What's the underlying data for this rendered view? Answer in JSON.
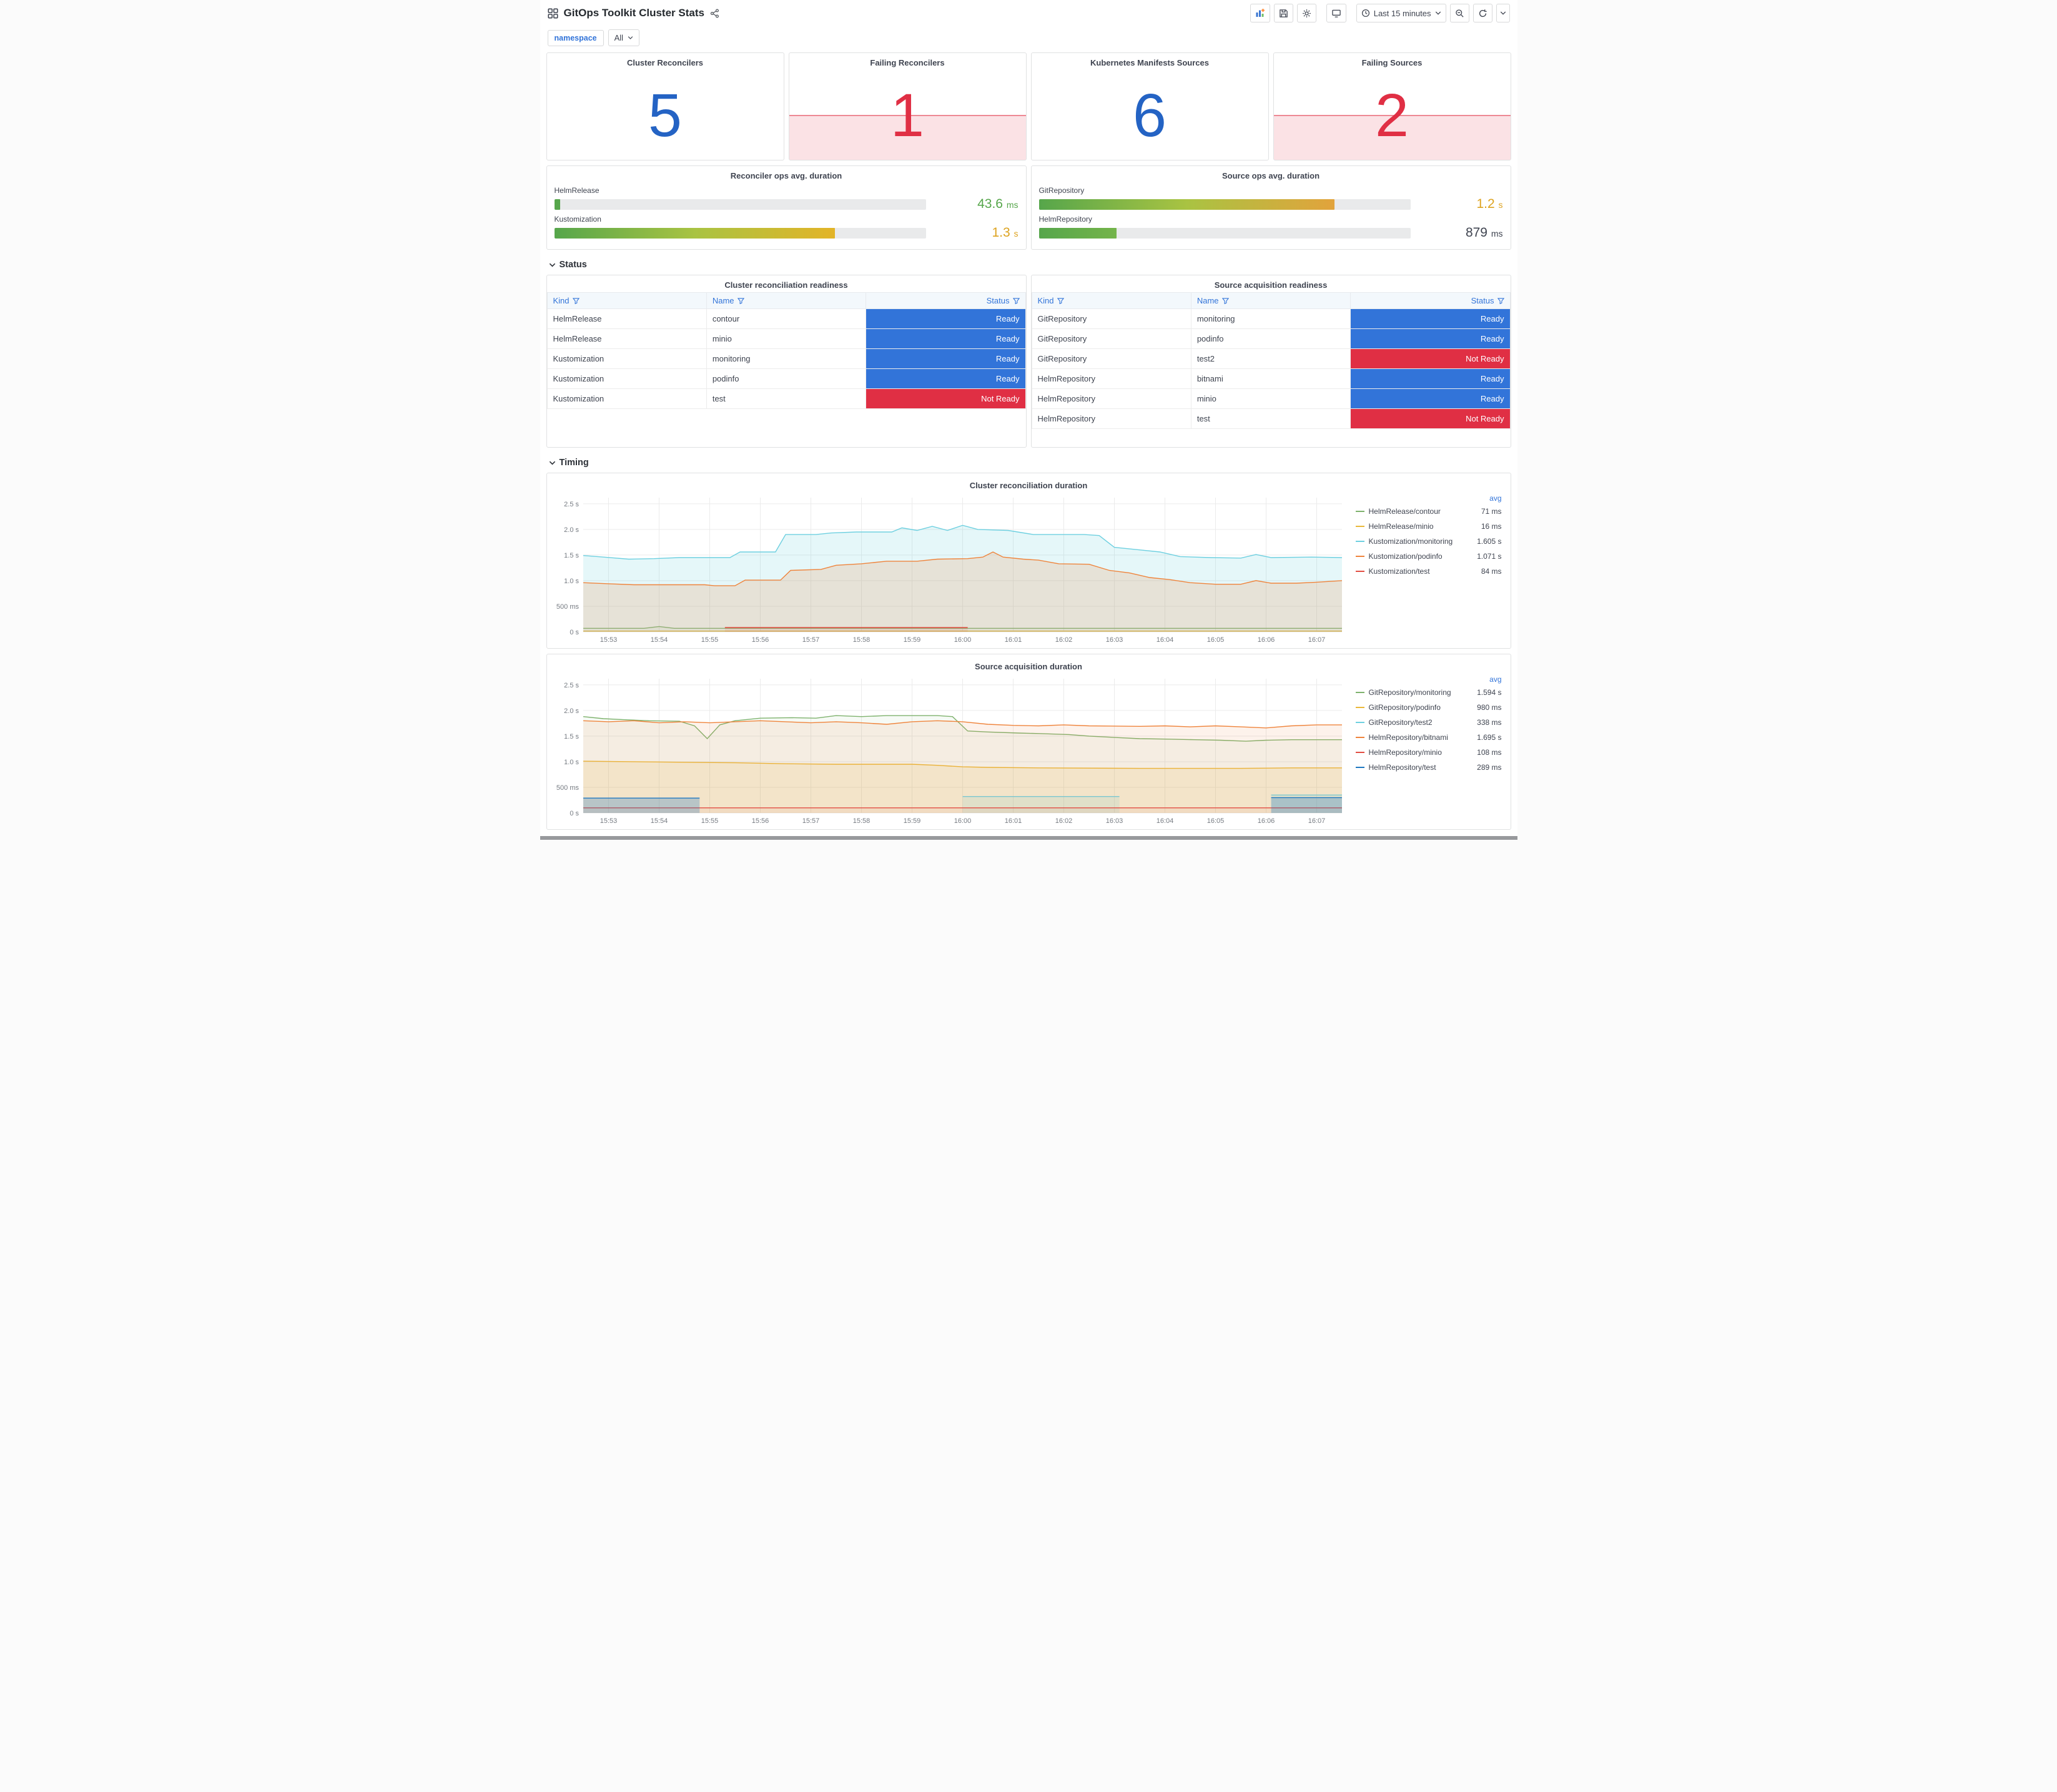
{
  "header": {
    "title": "GitOps Toolkit Cluster Stats"
  },
  "toolbar": {
    "time_range": "Last 15 minutes",
    "icons": [
      "add-panel",
      "save",
      "settings",
      "tv-mode",
      "clock",
      "zoom-out",
      "refresh",
      "caret-down"
    ]
  },
  "variables": {
    "label": "namespace",
    "value": "All"
  },
  "sections": {
    "status": "Status",
    "timing": "Timing"
  },
  "theme": {
    "accent_blue": "#3274d9",
    "stat_blue": "#2463c4",
    "stat_red": "#e02f44",
    "ready_blue": "#3274d9",
    "not_ready_red": "#e02f44",
    "gauge_green": "#56a64b",
    "gauge_yellow": "#e3b427",
    "text_dark": "#3f4450"
  },
  "stats": [
    {
      "title": "Cluster Reconcilers",
      "value": "5",
      "color": "#2463c4",
      "alert": false
    },
    {
      "title": "Failing Reconcilers",
      "value": "1",
      "color": "#e02f44",
      "alert": true
    },
    {
      "title": "Kubernetes Manifests Sources",
      "value": "6",
      "color": "#2463c4",
      "alert": false
    },
    {
      "title": "Failing Sources",
      "value": "2",
      "color": "#e02f44",
      "alert": true
    }
  ],
  "gauges": [
    {
      "title": "Reconciler ops avg. duration",
      "bars": [
        {
          "label": "HelmRelease",
          "value": "43.6",
          "unit": "ms",
          "pct": 1.6,
          "colors": [
            "#56a64b"
          ],
          "value_color": "#56a64b"
        },
        {
          "label": "Kustomization",
          "value": "1.3",
          "unit": "s",
          "pct": 75.5,
          "colors": [
            "#56a64b",
            "#a9c342",
            "#e3b427"
          ],
          "value_color": "#dda320"
        }
      ]
    },
    {
      "title": "Source ops avg. duration",
      "bars": [
        {
          "label": "GitRepository",
          "value": "1.2",
          "unit": "s",
          "pct": 79.5,
          "colors": [
            "#56a64b",
            "#a9c342",
            "#e2a33c"
          ],
          "value_color": "#dda320"
        },
        {
          "label": "HelmRepository",
          "value": "879",
          "unit": "ms",
          "pct": 21,
          "colors": [
            "#56a64b",
            "#74b44a"
          ],
          "value_color": "#3f4450"
        }
      ]
    }
  ],
  "tables": [
    {
      "title": "Cluster reconciliation readiness",
      "columns": [
        "Kind",
        "Name",
        "Status"
      ],
      "rows": [
        {
          "kind": "HelmRelease",
          "name": "contour",
          "status": "Ready",
          "ok": true
        },
        {
          "kind": "HelmRelease",
          "name": "minio",
          "status": "Ready",
          "ok": true
        },
        {
          "kind": "Kustomization",
          "name": "monitoring",
          "status": "Ready",
          "ok": true
        },
        {
          "kind": "Kustomization",
          "name": "podinfo",
          "status": "Ready",
          "ok": true
        },
        {
          "kind": "Kustomization",
          "name": "test",
          "status": "Not Ready",
          "ok": false
        }
      ]
    },
    {
      "title": "Source acquisition readiness",
      "columns": [
        "Kind",
        "Name",
        "Status"
      ],
      "rows": [
        {
          "kind": "GitRepository",
          "name": "monitoring",
          "status": "Ready",
          "ok": true
        },
        {
          "kind": "GitRepository",
          "name": "podinfo",
          "status": "Ready",
          "ok": true
        },
        {
          "kind": "GitRepository",
          "name": "test2",
          "status": "Not Ready",
          "ok": false
        },
        {
          "kind": "HelmRepository",
          "name": "bitnami",
          "status": "Ready",
          "ok": true
        },
        {
          "kind": "HelmRepository",
          "name": "minio",
          "status": "Ready",
          "ok": true
        },
        {
          "kind": "HelmRepository",
          "name": "test",
          "status": "Not Ready",
          "ok": false
        }
      ]
    }
  ],
  "chart_data": [
    {
      "type": "line",
      "title": "Cluster reconciliation duration",
      "legend_header": "avg",
      "xmin": 0,
      "xmax": 15,
      "ymin": 0,
      "ymax": 2.62,
      "grid": true,
      "legend_position": "right",
      "xticks": [
        "15:53",
        "15:54",
        "15:55",
        "15:56",
        "15:57",
        "15:58",
        "15:59",
        "16:00",
        "16:01",
        "16:02",
        "16:03",
        "16:04",
        "16:05",
        "16:06",
        "16:07"
      ],
      "yticks": [
        {
          "v": 0,
          "label": "0 s"
        },
        {
          "v": 0.5,
          "label": "500 ms"
        },
        {
          "v": 1,
          "label": "1.0 s"
        },
        {
          "v": 1.5,
          "label": "1.5 s"
        },
        {
          "v": 2,
          "label": "2.0 s"
        },
        {
          "v": 2.5,
          "label": "2.5 s"
        }
      ],
      "series": [
        {
          "name": "HelmRelease/contour",
          "avg": "71 ms",
          "color": "#7eb26d",
          "fill_opacity": 0.08,
          "points": [
            [
              0,
              0.07
            ],
            [
              1.2,
              0.07
            ],
            [
              1.5,
              0.105
            ],
            [
              1.8,
              0.07
            ],
            [
              15,
              0.07
            ]
          ]
        },
        {
          "name": "HelmRelease/minio",
          "avg": "16 ms",
          "color": "#eab839",
          "fill_opacity": 0.06,
          "points": [
            [
              0,
              0.016
            ],
            [
              15,
              0.016
            ]
          ]
        },
        {
          "name": "Kustomization/monitoring",
          "avg": "1.605 s",
          "color": "#6ed0e0",
          "fill_opacity": 0.18,
          "points": [
            [
              0,
              1.49
            ],
            [
              0.4,
              1.46
            ],
            [
              0.9,
              1.42
            ],
            [
              1.4,
              1.43
            ],
            [
              1.9,
              1.45
            ],
            [
              2.9,
              1.45
            ],
            [
              3.1,
              1.56
            ],
            [
              3.8,
              1.56
            ],
            [
              4,
              1.9
            ],
            [
              4.6,
              1.9
            ],
            [
              4.9,
              1.93
            ],
            [
              5.4,
              1.95
            ],
            [
              6.1,
              1.95
            ],
            [
              6.3,
              2.03
            ],
            [
              6.6,
              1.98
            ],
            [
              6.9,
              2.06
            ],
            [
              7.2,
              1.98
            ],
            [
              7.5,
              2.08
            ],
            [
              7.8,
              2.0
            ],
            [
              8.4,
              1.98
            ],
            [
              8.9,
              1.9
            ],
            [
              9.9,
              1.9
            ],
            [
              10.2,
              1.88
            ],
            [
              10.5,
              1.65
            ],
            [
              11,
              1.6
            ],
            [
              11.4,
              1.56
            ],
            [
              11.8,
              1.47
            ],
            [
              12.4,
              1.45
            ],
            [
              13,
              1.44
            ],
            [
              13.3,
              1.51
            ],
            [
              13.6,
              1.45
            ],
            [
              14.4,
              1.46
            ],
            [
              15,
              1.45
            ]
          ]
        },
        {
          "name": "Kustomization/podinfo",
          "avg": "1.071 s",
          "color": "#ef843c",
          "fill_opacity": 0.18,
          "points": [
            [
              0,
              0.96
            ],
            [
              0.5,
              0.94
            ],
            [
              1,
              0.92
            ],
            [
              2.4,
              0.92
            ],
            [
              2.6,
              0.9
            ],
            [
              3,
              0.9
            ],
            [
              3.2,
              1.01
            ],
            [
              3.9,
              1.01
            ],
            [
              4.1,
              1.2
            ],
            [
              4.7,
              1.22
            ],
            [
              5,
              1.3
            ],
            [
              5.5,
              1.33
            ],
            [
              6,
              1.38
            ],
            [
              6.6,
              1.38
            ],
            [
              7,
              1.42
            ],
            [
              7.6,
              1.43
            ],
            [
              7.9,
              1.46
            ],
            [
              8.1,
              1.56
            ],
            [
              8.3,
              1.46
            ],
            [
              8.7,
              1.42
            ],
            [
              9,
              1.4
            ],
            [
              9.4,
              1.33
            ],
            [
              10,
              1.32
            ],
            [
              10.4,
              1.2
            ],
            [
              10.8,
              1.15
            ],
            [
              11.2,
              1.06
            ],
            [
              11.6,
              1.02
            ],
            [
              12,
              0.96
            ],
            [
              12.5,
              0.93
            ],
            [
              13,
              0.93
            ],
            [
              13.3,
              1.0
            ],
            [
              13.6,
              0.95
            ],
            [
              14.1,
              0.95
            ],
            [
              14.5,
              0.97
            ],
            [
              15,
              1.0
            ]
          ]
        },
        {
          "name": "Kustomization/test",
          "avg": "84 ms",
          "color": "#e24d42",
          "fill_opacity": 0.1,
          "points": [
            [
              2.8,
              0.085
            ],
            [
              7.6,
              0.085
            ]
          ]
        }
      ]
    },
    {
      "type": "line",
      "title": "Source acquisition duration",
      "legend_header": "avg",
      "xmin": 0,
      "xmax": 15,
      "ymin": 0,
      "ymax": 2.62,
      "grid": true,
      "legend_position": "right",
      "xticks": [
        "15:53",
        "15:54",
        "15:55",
        "15:56",
        "15:57",
        "15:58",
        "15:59",
        "16:00",
        "16:01",
        "16:02",
        "16:03",
        "16:04",
        "16:05",
        "16:06",
        "16:07"
      ],
      "yticks": [
        {
          "v": 0,
          "label": "0 s"
        },
        {
          "v": 0.5,
          "label": "500 ms"
        },
        {
          "v": 1,
          "label": "1.0 s"
        },
        {
          "v": 1.5,
          "label": "1.5 s"
        },
        {
          "v": 2,
          "label": "2.0 s"
        },
        {
          "v": 2.5,
          "label": "2.5 s"
        }
      ],
      "series": [
        {
          "name": "GitRepository/monitoring",
          "avg": "1.594 s",
          "color": "#7eb26d",
          "fill_opacity": 0.07,
          "points": [
            [
              0,
              1.88
            ],
            [
              0.4,
              1.84
            ],
            [
              0.8,
              1.82
            ],
            [
              1.3,
              1.8
            ],
            [
              1.9,
              1.79
            ],
            [
              2.2,
              1.7
            ],
            [
              2.45,
              1.45
            ],
            [
              2.7,
              1.72
            ],
            [
              3,
              1.8
            ],
            [
              3.5,
              1.85
            ],
            [
              4.1,
              1.86
            ],
            [
              4.6,
              1.85
            ],
            [
              5,
              1.9
            ],
            [
              5.5,
              1.88
            ],
            [
              6,
              1.9
            ],
            [
              7,
              1.9
            ],
            [
              7.3,
              1.88
            ],
            [
              7.6,
              1.6
            ],
            [
              8,
              1.58
            ],
            [
              8.6,
              1.56
            ],
            [
              9,
              1.55
            ],
            [
              9.6,
              1.53
            ],
            [
              10,
              1.5
            ],
            [
              10.6,
              1.47
            ],
            [
              11,
              1.45
            ],
            [
              11.6,
              1.44
            ],
            [
              12.1,
              1.43
            ],
            [
              12.6,
              1.42
            ],
            [
              13.1,
              1.4
            ],
            [
              13.5,
              1.42
            ],
            [
              14,
              1.43
            ],
            [
              15,
              1.43
            ]
          ]
        },
        {
          "name": "GitRepository/podinfo",
          "avg": "980 ms",
          "color": "#eab839",
          "fill_opacity": 0.14,
          "points": [
            [
              0,
              1.01
            ],
            [
              1,
              1.0
            ],
            [
              2,
              0.99
            ],
            [
              3,
              0.98
            ],
            [
              4,
              0.96
            ],
            [
              5,
              0.95
            ],
            [
              6.5,
              0.95
            ],
            [
              7,
              0.93
            ],
            [
              7.5,
              0.9
            ],
            [
              8,
              0.89
            ],
            [
              9,
              0.88
            ],
            [
              11,
              0.87
            ],
            [
              13,
              0.87
            ],
            [
              14,
              0.88
            ],
            [
              15,
              0.88
            ]
          ]
        },
        {
          "name": "GitRepository/test2",
          "avg": "338 ms",
          "color": "#6ed0e0",
          "fill_opacity": 0.15,
          "points": [
            [
              7.5,
              0.32
            ],
            [
              10.6,
              0.32
            ],
            null,
            [
              13.6,
              0.35
            ],
            [
              15,
              0.35
            ]
          ]
        },
        {
          "name": "HelmRepository/bitnami",
          "avg": "1.695 s",
          "color": "#ef843c",
          "fill_opacity": 0.1,
          "points": [
            [
              0,
              1.8
            ],
            [
              0.5,
              1.78
            ],
            [
              1,
              1.8
            ],
            [
              1.5,
              1.76
            ],
            [
              2,
              1.78
            ],
            [
              2.5,
              1.76
            ],
            [
              3,
              1.78
            ],
            [
              3.5,
              1.8
            ],
            [
              4,
              1.78
            ],
            [
              4.5,
              1.76
            ],
            [
              5,
              1.78
            ],
            [
              5.5,
              1.76
            ],
            [
              6,
              1.73
            ],
            [
              6.5,
              1.78
            ],
            [
              7,
              1.8
            ],
            [
              7.5,
              1.78
            ],
            [
              8,
              1.73
            ],
            [
              8.5,
              1.71
            ],
            [
              9,
              1.7
            ],
            [
              9.5,
              1.72
            ],
            [
              10,
              1.7
            ],
            [
              11,
              1.69
            ],
            [
              11.5,
              1.7
            ],
            [
              12,
              1.68
            ],
            [
              12.5,
              1.7
            ],
            [
              13,
              1.68
            ],
            [
              13.5,
              1.66
            ],
            [
              14,
              1.7
            ],
            [
              14.5,
              1.72
            ],
            [
              15,
              1.72
            ]
          ]
        },
        {
          "name": "HelmRepository/minio",
          "avg": "108 ms",
          "color": "#e24d42",
          "fill_opacity": 0.06,
          "points": [
            [
              0,
              0.1
            ],
            [
              15,
              0.1
            ]
          ]
        },
        {
          "name": "HelmRepository/test",
          "avg": "289 ms",
          "color": "#1f78c1",
          "fill_opacity": 0.28,
          "points": [
            [
              0,
              0.29
            ],
            [
              2.3,
              0.29
            ],
            null,
            [
              13.6,
              0.3
            ],
            [
              15,
              0.3
            ]
          ]
        }
      ]
    }
  ]
}
